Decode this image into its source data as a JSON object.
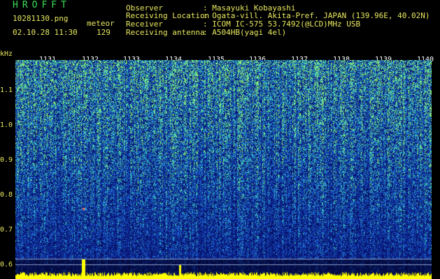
{
  "header": {
    "title": "HROFFT",
    "filename": "10281130.png",
    "datetime": "02.10.28 11:30",
    "type_label": "meteor",
    "count": "129",
    "observer_label": "Observer",
    "observer_value": ": Masayuki Kobayashi",
    "location_label": "Receiving Location",
    "location_value": ": Ogata-vill. Akita-Pref. JAPAN (139.96E, 40.02N)",
    "receiver_label": "Receiver",
    "receiver_value": ": ICOM IC-575 53.7492(@LCD)MHz USB",
    "antenna_label": "Receiving antenna",
    "antenna_value": ": A504HB(yagi 4el)"
  },
  "axis": {
    "unit": "kHz",
    "y_ticks": [
      "1.1",
      "1.0",
      "0.9",
      "0.8",
      "0.7",
      "0.6"
    ],
    "time_ticks": [
      "1131",
      "1132",
      "1133",
      "1134",
      "1135",
      "1136",
      "1137",
      "1138",
      "1139",
      "1140"
    ]
  },
  "colors": {
    "background": "#000000",
    "text": "#e8e860",
    "title": "#3be05a",
    "low": "#0a1a8a",
    "mid": "#1d6fd8",
    "high": "#3fd6b8",
    "peak": "#9cff6a",
    "baseline": "#ffff00"
  }
}
